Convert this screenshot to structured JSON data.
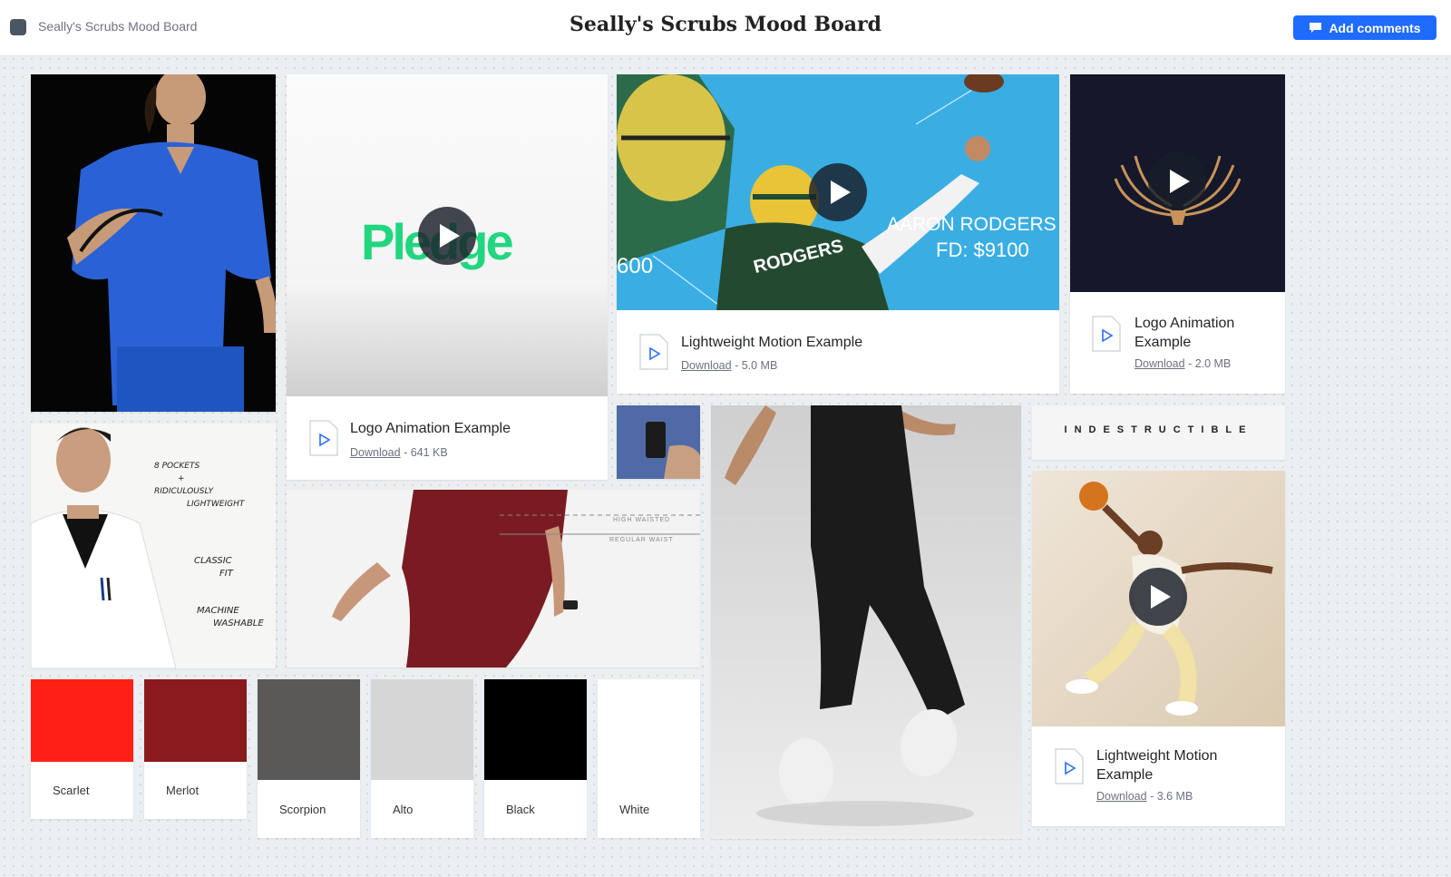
{
  "header": {
    "app_name": "Seally's Scrubs Mood Board",
    "title": "Seally's Scrubs Mood Board",
    "add_comments_label": "Add comments"
  },
  "files": [
    {
      "name": "Logo Animation Example",
      "download": "Download",
      "size": "641 KB"
    },
    {
      "name": "Lightweight Motion Example",
      "download": "Download",
      "size": "5.0 MB"
    },
    {
      "name": "Logo Animation Example",
      "download": "Download",
      "size": "2.0 MB"
    },
    {
      "name": "Lightweight Motion Example",
      "download": "Download",
      "size": "3.6 MB"
    }
  ],
  "images": {
    "pledge_logo_text": "Pledge",
    "football_player_name": "AARON RODGERS",
    "football_price": "FD: $9100",
    "football_jersey_name": "RODGERS",
    "football_score": "600",
    "waist_high": "HIGH WAISTED",
    "waist_regular": "REGULAR WAIST",
    "indestructible": "INDESTRUCTIBLE",
    "notes": [
      "8 POCKETS",
      "+",
      "RIDICULOUSLY",
      "LIGHTWEIGHT",
      "CLASSIC",
      "FIT",
      "MACHINE",
      "WASHABLE"
    ]
  },
  "swatches": [
    {
      "name": "Scarlet",
      "color": "#ff2015"
    },
    {
      "name": "Merlot",
      "color": "#8b1a1d"
    },
    {
      "name": "Scorpion",
      "color": "#5b5958"
    },
    {
      "name": "Alto",
      "color": "#d6d6d6"
    },
    {
      "name": "Black",
      "color": "#000000"
    },
    {
      "name": "White",
      "color": "#ffffff"
    }
  ],
  "colors": {
    "accent": "#1f6bff",
    "file_icon": "#2b6df5",
    "pledge_green": "#22d680",
    "sky_blue": "#3aaee3"
  }
}
